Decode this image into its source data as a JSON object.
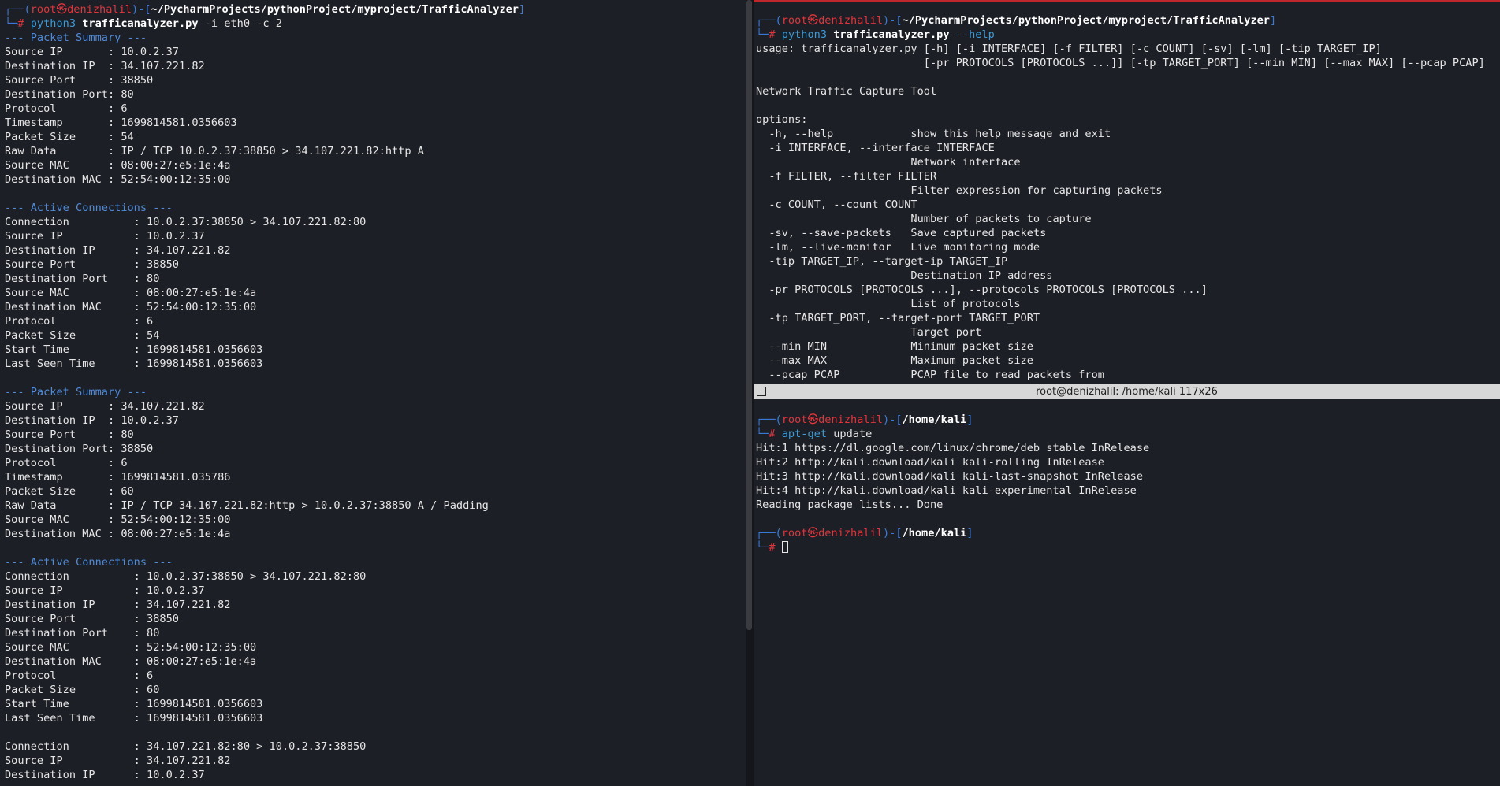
{
  "left_pane": {
    "prompt_user": "root",
    "prompt_at": "㉿",
    "prompt_host": "denizhalil",
    "prompt_path": "~/PycharmProjects/pythonProject/myproject/TrafficAnalyzer",
    "cmd_python": "python3",
    "cmd_script": "trafficanalyzer.py",
    "cmd_args": "-i eth0 -c 2",
    "lines": [
      {
        "t": "h",
        "text": "--- Packet Summary ---"
      },
      {
        "t": "n",
        "text": "Source IP       : 10.0.2.37"
      },
      {
        "t": "n",
        "text": "Destination IP  : 34.107.221.82"
      },
      {
        "t": "n",
        "text": "Source Port     : 38850"
      },
      {
        "t": "n",
        "text": "Destination Port: 80"
      },
      {
        "t": "n",
        "text": "Protocol        : 6"
      },
      {
        "t": "n",
        "text": "Timestamp       : 1699814581.0356603"
      },
      {
        "t": "n",
        "text": "Packet Size     : 54"
      },
      {
        "t": "n",
        "text": "Raw Data        : IP / TCP 10.0.2.37:38850 > 34.107.221.82:http A"
      },
      {
        "t": "n",
        "text": "Source MAC      : 08:00:27:e5:1e:4a"
      },
      {
        "t": "n",
        "text": "Destination MAC : 52:54:00:12:35:00"
      },
      {
        "t": "n",
        "text": ""
      },
      {
        "t": "h",
        "text": "--- Active Connections ---"
      },
      {
        "t": "n",
        "text": "Connection          : 10.0.2.37:38850 > 34.107.221.82:80"
      },
      {
        "t": "n",
        "text": "Source IP           : 10.0.2.37"
      },
      {
        "t": "n",
        "text": "Destination IP      : 34.107.221.82"
      },
      {
        "t": "n",
        "text": "Source Port         : 38850"
      },
      {
        "t": "n",
        "text": "Destination Port    : 80"
      },
      {
        "t": "n",
        "text": "Source MAC          : 08:00:27:e5:1e:4a"
      },
      {
        "t": "n",
        "text": "Destination MAC     : 52:54:00:12:35:00"
      },
      {
        "t": "n",
        "text": "Protocol            : 6"
      },
      {
        "t": "n",
        "text": "Packet Size         : 54"
      },
      {
        "t": "n",
        "text": "Start Time          : 1699814581.0356603"
      },
      {
        "t": "n",
        "text": "Last Seen Time      : 1699814581.0356603"
      },
      {
        "t": "n",
        "text": ""
      },
      {
        "t": "h",
        "text": "--- Packet Summary ---"
      },
      {
        "t": "n",
        "text": "Source IP       : 34.107.221.82"
      },
      {
        "t": "n",
        "text": "Destination IP  : 10.0.2.37"
      },
      {
        "t": "n",
        "text": "Source Port     : 80"
      },
      {
        "t": "n",
        "text": "Destination Port: 38850"
      },
      {
        "t": "n",
        "text": "Protocol        : 6"
      },
      {
        "t": "n",
        "text": "Timestamp       : 1699814581.035786"
      },
      {
        "t": "n",
        "text": "Packet Size     : 60"
      },
      {
        "t": "n",
        "text": "Raw Data        : IP / TCP 34.107.221.82:http > 10.0.2.37:38850 A / Padding"
      },
      {
        "t": "n",
        "text": "Source MAC      : 52:54:00:12:35:00"
      },
      {
        "t": "n",
        "text": "Destination MAC : 08:00:27:e5:1e:4a"
      },
      {
        "t": "n",
        "text": ""
      },
      {
        "t": "h",
        "text": "--- Active Connections ---"
      },
      {
        "t": "n",
        "text": "Connection          : 10.0.2.37:38850 > 34.107.221.82:80"
      },
      {
        "t": "n",
        "text": "Source IP           : 10.0.2.37"
      },
      {
        "t": "n",
        "text": "Destination IP      : 34.107.221.82"
      },
      {
        "t": "n",
        "text": "Source Port         : 38850"
      },
      {
        "t": "n",
        "text": "Destination Port    : 80"
      },
      {
        "t": "n",
        "text": "Source MAC          : 52:54:00:12:35:00"
      },
      {
        "t": "n",
        "text": "Destination MAC     : 08:00:27:e5:1e:4a"
      },
      {
        "t": "n",
        "text": "Protocol            : 6"
      },
      {
        "t": "n",
        "text": "Packet Size         : 60"
      },
      {
        "t": "n",
        "text": "Start Time          : 1699814581.0356603"
      },
      {
        "t": "n",
        "text": "Last Seen Time      : 1699814581.0356603"
      },
      {
        "t": "n",
        "text": ""
      },
      {
        "t": "n",
        "text": "Connection          : 34.107.221.82:80 > 10.0.2.37:38850"
      },
      {
        "t": "n",
        "text": "Source IP           : 34.107.221.82"
      },
      {
        "t": "n",
        "text": "Destination IP      : 10.0.2.37"
      }
    ]
  },
  "right_top": {
    "prompt_user": "root",
    "prompt_at": "㉿",
    "prompt_host": "denizhalil",
    "prompt_path": "~/PycharmProjects/pythonProject/myproject/TrafficAnalyzer",
    "cmd_python": "python3",
    "cmd_script": "trafficanalyzer.py",
    "cmd_args": "--help",
    "lines": [
      "usage: trafficanalyzer.py [-h] [-i INTERFACE] [-f FILTER] [-c COUNT] [-sv] [-lm] [-tip TARGET_IP]",
      "                          [-pr PROTOCOLS [PROTOCOLS ...]] [-tp TARGET_PORT] [--min MIN] [--max MAX] [--pcap PCAP]",
      "",
      "Network Traffic Capture Tool",
      "",
      "options:",
      "  -h, --help            show this help message and exit",
      "  -i INTERFACE, --interface INTERFACE",
      "                        Network interface",
      "  -f FILTER, --filter FILTER",
      "                        Filter expression for capturing packets",
      "  -c COUNT, --count COUNT",
      "                        Number of packets to capture",
      "  -sv, --save-packets   Save captured packets",
      "  -lm, --live-monitor   Live monitoring mode",
      "  -tip TARGET_IP, --target-ip TARGET_IP",
      "                        Destination IP address",
      "  -pr PROTOCOLS [PROTOCOLS ...], --protocols PROTOCOLS [PROTOCOLS ...]",
      "                        List of protocols",
      "  -tp TARGET_PORT, --target-port TARGET_PORT",
      "                        Target port",
      "  --min MIN             Minimum packet size",
      "  --max MAX             Maximum packet size",
      "  --pcap PCAP           PCAP file to read packets from"
    ]
  },
  "tmux_bar": {
    "title": "root@denizhalil: /home/kali 117x26"
  },
  "right_bottom": {
    "prompt_user": "root",
    "prompt_at": "㉿",
    "prompt_host": "denizhalil",
    "prompt_path": "/home/kali",
    "cmd_name": "apt-get",
    "cmd_args": "update",
    "lines": [
      "Hit:1 https://dl.google.com/linux/chrome/deb stable InRelease",
      "Hit:2 http://kali.download/kali kali-rolling InRelease",
      "Hit:3 http://kali.download/kali kali-last-snapshot InRelease",
      "Hit:4 http://kali.download/kali kali-experimental InRelease",
      "Reading package lists... Done"
    ],
    "prompt2_path": "/home/kali"
  }
}
